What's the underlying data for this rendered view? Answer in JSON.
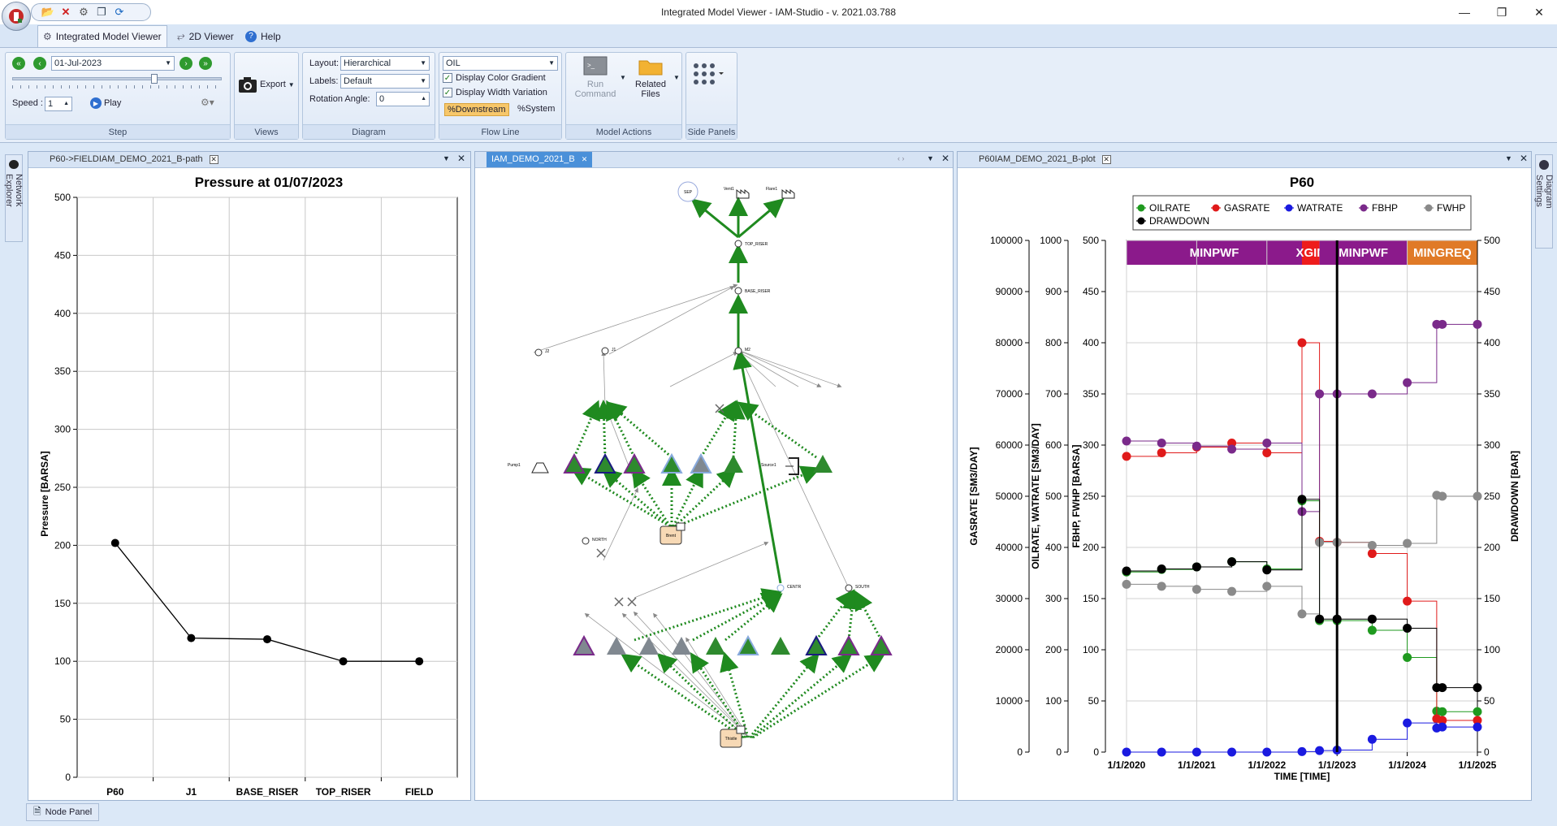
{
  "window": {
    "title": "Integrated Model Viewer - IAM-Studio - v. 2021.03.788"
  },
  "ribbon_tabs": [
    {
      "label": "Integrated Model Viewer",
      "icon": "model-viewer-icon"
    },
    {
      "label": "2D Viewer",
      "icon": "viewer-2d-icon"
    },
    {
      "label": "Help",
      "icon": "help-icon"
    }
  ],
  "step_group": {
    "date": "01-Jul-2023",
    "speed_label": "Speed :",
    "speed_value": "1",
    "play_label": "Play",
    "group_label": "Step",
    "slider_fraction": 0.68
  },
  "views_group": {
    "export_label": "Export",
    "group_label": "Views"
  },
  "diagram_group": {
    "layout_label": "Layout:",
    "layout_value": "Hierarchical",
    "labels_label": "Labels:",
    "labels_value": "Default",
    "rotation_label": "Rotation Angle:",
    "rotation_value": "0",
    "group_label": "Diagram"
  },
  "flowline_group": {
    "phase_value": "OIL",
    "gradient_label": "Display Color Gradient",
    "width_label": "Display Width Variation",
    "downstream_label": "%Downstream",
    "system_label": "%System",
    "group_label": "Flow Line"
  },
  "model_actions_group": {
    "run_label_1": "Run",
    "run_label_2": "Command",
    "files_label_1": "Related",
    "files_label_2": "Files",
    "group_label": "Model Actions"
  },
  "side_panels_group": {
    "group_label": "Side Panels"
  },
  "side_tabs": {
    "left": "Network Explorer",
    "right": "Diagram Settings",
    "bottom": "Node Panel"
  },
  "panels": {
    "left_tab": "P60->FIELDIAM_DEMO_2021_B-path",
    "center_tab": "IAM_DEMO_2021_B",
    "right_tab": "P60IAM_DEMO_2021_B-plot"
  },
  "pressure_chart": {
    "chart_data": {
      "type": "line",
      "title": "Pressure at 01/07/2023",
      "ylabel": "Pressure [BARSA]",
      "categories": [
        "P60",
        "J1",
        "BASE_RISER",
        "TOP_RISER",
        "FIELD"
      ],
      "values": [
        202,
        120,
        119,
        100,
        100
      ],
      "ylim": [
        0,
        500
      ],
      "yticks": [
        0,
        50,
        100,
        150,
        200,
        250,
        300,
        350,
        400,
        450,
        500
      ],
      "grid": true,
      "color": "#000000"
    }
  },
  "network": {
    "labels": {
      "sep": "SEP",
      "vent": "Vent1",
      "flare": "Flare1",
      "top_riser": "TOP_RISER",
      "base_riser": "BASE_RISER",
      "j2": "J2",
      "j1": "J1",
      "m2": "M2",
      "pump": "Pump1",
      "source": "Source1",
      "north": "NORTH",
      "centr": "CENTR",
      "south": "SOUTH",
      "man1": "Brent",
      "man2": "Thistle"
    },
    "colors": {
      "flow": "#1f8a1f",
      "node_green": "#1f8a1f",
      "node_gray": "#808890",
      "manifold": "#f7d9b5"
    }
  },
  "p60_chart": {
    "chart_data": {
      "type": "line",
      "title": "P60",
      "xlabel": "TIME [TIME]",
      "y_axes": [
        {
          "label": "GASRATE [SM3/DAY]",
          "range": [
            0,
            100000
          ],
          "ticks": [
            0,
            10000,
            20000,
            30000,
            40000,
            50000,
            60000,
            70000,
            80000,
            90000,
            100000
          ]
        },
        {
          "label": "OILRATE, WATRATE [SM3/DAY]",
          "range": [
            0,
            1000
          ],
          "ticks": [
            0,
            100,
            200,
            300,
            400,
            500,
            600,
            700,
            800,
            900,
            1000
          ]
        },
        {
          "label": "FBHP, FWHP [BARSA]",
          "range": [
            0,
            500
          ],
          "ticks": [
            0,
            50,
            100,
            150,
            200,
            250,
            300,
            350,
            400,
            450,
            500
          ]
        },
        {
          "label": "DRAWDOWN [BAR]",
          "range": [
            0,
            500
          ],
          "ticks": [
            0,
            50,
            100,
            150,
            200,
            250,
            300,
            350,
            400,
            450,
            500
          ]
        }
      ],
      "x_ticks": [
        "1/1/2020",
        "1/1/2021",
        "1/1/2022",
        "1/1/2023",
        "1/1/2024",
        "1/1/2025"
      ],
      "x_range": [
        2020.0,
        2025.0
      ],
      "current_time": 2023.0,
      "grid": true,
      "legend_position": "top",
      "constraint_bands": [
        {
          "label": "MINPWF",
          "from": 2020.0,
          "to": 2022.5,
          "color": "#8b1a8b"
        },
        {
          "label": "XGIN",
          "from": 2022.5,
          "to": 2022.75,
          "color": "#ee1c1c"
        },
        {
          "label": "MINPWF",
          "from": 2022.75,
          "to": 2024.0,
          "color": "#8b1a8b"
        },
        {
          "label": "MINGREQ",
          "from": 2024.0,
          "to": 2025.0,
          "color": "#e07a27"
        }
      ],
      "series": [
        {
          "name": "OILRATE",
          "axis": 1,
          "color": "#1f9a1f",
          "points": [
            [
              2020,
              352
            ],
            [
              2020.5,
              357
            ],
            [
              2021,
              362
            ],
            [
              2021.5,
              372
            ],
            [
              2022,
              358
            ],
            [
              2022.5,
              491
            ],
            [
              2022.75,
              257
            ],
            [
              2023,
              257
            ],
            [
              2023.5,
              238
            ],
            [
              2024,
              185
            ],
            [
              2024.42,
              80
            ],
            [
              2024.5,
              79
            ],
            [
              2025,
              79
            ]
          ]
        },
        {
          "name": "GASRATE",
          "axis": 0,
          "color": "#e01a1a",
          "points": [
            [
              2020,
              57800
            ],
            [
              2020.5,
              58500
            ],
            [
              2021,
              59600
            ],
            [
              2021.5,
              60400
            ],
            [
              2022,
              58500
            ],
            [
              2022.5,
              80000
            ],
            [
              2022.75,
              41200
            ],
            [
              2023,
              41000
            ],
            [
              2023.5,
              38800
            ],
            [
              2024,
              29500
            ],
            [
              2024.42,
              6500
            ],
            [
              2024.5,
              6200
            ],
            [
              2025,
              6200
            ]
          ]
        },
        {
          "name": "WATRATE",
          "axis": 1,
          "color": "#1a1ae0",
          "points": [
            [
              2020,
              0
            ],
            [
              2020.5,
              0
            ],
            [
              2021,
              0
            ],
            [
              2021.5,
              0
            ],
            [
              2022,
              0
            ],
            [
              2022.5,
              1
            ],
            [
              2022.75,
              3
            ],
            [
              2023,
              4
            ],
            [
              2023.5,
              25
            ],
            [
              2024,
              57
            ],
            [
              2024.42,
              47
            ],
            [
              2024.5,
              49
            ],
            [
              2025,
              49
            ]
          ]
        },
        {
          "name": "FBHP",
          "axis": 2,
          "color": "#7a2a8a",
          "points": [
            [
              2020,
              304
            ],
            [
              2020.5,
              302
            ],
            [
              2021,
              299
            ],
            [
              2021.5,
              296
            ],
            [
              2022,
              302
            ],
            [
              2022.5,
              235
            ],
            [
              2022.75,
              350
            ],
            [
              2023,
              350
            ],
            [
              2023.5,
              350
            ],
            [
              2024,
              361
            ],
            [
              2024.42,
              418
            ],
            [
              2024.5,
              418
            ],
            [
              2025,
              418
            ]
          ]
        },
        {
          "name": "FWHP",
          "axis": 2,
          "color": "#8a8a8a",
          "points": [
            [
              2020,
              164
            ],
            [
              2020.5,
              162
            ],
            [
              2021,
              159
            ],
            [
              2021.5,
              157
            ],
            [
              2022,
              162
            ],
            [
              2022.5,
              135
            ],
            [
              2022.75,
              205
            ],
            [
              2023,
              205
            ],
            [
              2023.5,
              202
            ],
            [
              2024,
              204
            ],
            [
              2024.42,
              251
            ],
            [
              2024.5,
              250
            ],
            [
              2025,
              250
            ]
          ]
        },
        {
          "name": "DRAWDOWN",
          "axis": 3,
          "color": "#000000",
          "points": [
            [
              2020,
              177
            ],
            [
              2020.5,
              179
            ],
            [
              2021,
              181
            ],
            [
              2021.5,
              186
            ],
            [
              2022,
              178
            ],
            [
              2022.5,
              247
            ],
            [
              2022.75,
              130
            ],
            [
              2023,
              130
            ],
            [
              2023.5,
              130
            ],
            [
              2024,
              121
            ],
            [
              2024.42,
              63
            ],
            [
              2024.5,
              63
            ],
            [
              2025,
              63
            ]
          ]
        }
      ]
    }
  }
}
